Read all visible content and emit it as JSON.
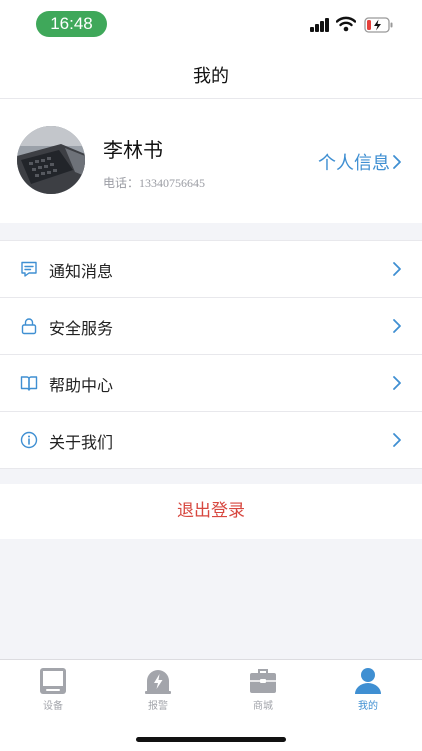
{
  "status_bar": {
    "time": "16:48",
    "time_pill_color": "#3fa85a"
  },
  "nav": {
    "title": "我的"
  },
  "profile": {
    "name": "李林书",
    "phone": "电话：13340756645",
    "info_link": "个人信息"
  },
  "menu": {
    "items": [
      {
        "label": "通知消息",
        "icon": "message-icon"
      },
      {
        "label": "安全服务",
        "icon": "lock-icon"
      },
      {
        "label": "帮助中心",
        "icon": "book-icon"
      },
      {
        "label": "关于我们",
        "icon": "info-icon"
      }
    ]
  },
  "logout": {
    "label": "退出登录",
    "color": "#d7473f"
  },
  "tabs": [
    {
      "label": "设备",
      "icon": "device-icon",
      "active": false
    },
    {
      "label": "报警",
      "icon": "alarm-icon",
      "active": false
    },
    {
      "label": "商城",
      "icon": "shop-icon",
      "active": false
    },
    {
      "label": "我的",
      "icon": "person-icon",
      "active": true
    }
  ],
  "colors": {
    "accent": "#3f8fd2",
    "inactive": "#a3a5ab",
    "page_bg": "#f3f4f8"
  }
}
